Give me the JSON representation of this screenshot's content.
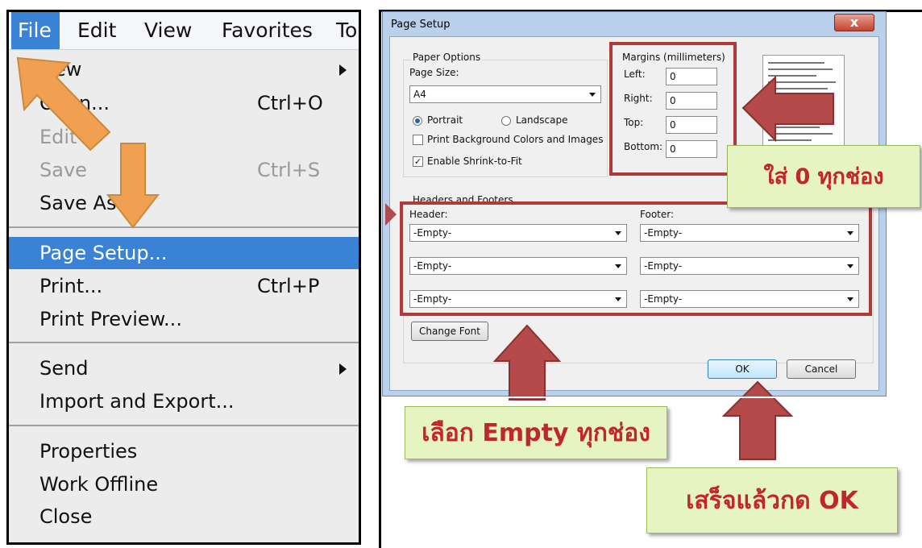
{
  "menubar": {
    "items": [
      "File",
      "Edit",
      "View",
      "Favorites",
      "To"
    ]
  },
  "file_menu": {
    "items": [
      {
        "label": "New",
        "submenu": true
      },
      {
        "label": "Open...",
        "shortcut": "Ctrl+O"
      },
      {
        "label": "Edit",
        "disabled": true
      },
      {
        "label": "Save",
        "shortcut": "Ctrl+S",
        "disabled": true
      },
      {
        "label": "Save As..."
      },
      {
        "label": "Page Setup...",
        "selected": true
      },
      {
        "label": "Print...",
        "shortcut": "Ctrl+P"
      },
      {
        "label": "Print Preview..."
      },
      {
        "label": "Send",
        "submenu": true
      },
      {
        "label": "Import and Export..."
      },
      {
        "label": "Properties"
      },
      {
        "label": "Work Offline"
      },
      {
        "label": "Close"
      }
    ]
  },
  "page_setup": {
    "title": "Page Setup",
    "close_glyph": "x",
    "paper_options": {
      "group_label": "Paper Options",
      "page_size_label": "Page Size:",
      "page_size_value": "A4",
      "portrait_label": "Portrait",
      "landscape_label": "Landscape",
      "orientation": "Portrait",
      "print_background_label": "Print Background Colors and Images",
      "print_background_checked": false,
      "shrink_label": "Enable Shrink-to-Fit",
      "shrink_checked": true
    },
    "margins": {
      "group_label": "Margins (millimeters)",
      "left_label": "Left:",
      "left_value": "0",
      "right_label": "Right:",
      "right_value": "0",
      "top_label": "Top:",
      "top_value": "0",
      "bottom_label": "Bottom:",
      "bottom_value": "0"
    },
    "headers_footers": {
      "group_label": "Headers and Footers",
      "header_label": "Header:",
      "footer_label": "Footer:",
      "header_values": [
        "-Empty-",
        "-Empty-",
        "-Empty-"
      ],
      "footer_values": [
        "-Empty-",
        "-Empty-",
        "-Empty-"
      ]
    },
    "change_font_label": "Change Font",
    "ok_label": "OK",
    "cancel_label": "Cancel"
  },
  "annotations": {
    "margins_note": "ใส่ 0 ทุกช่อง",
    "headers_note": "เลือก Empty ทุกช่อง",
    "ok_note": "เสร็จแล้วกด  OK",
    "colors": {
      "box": "#b03a3a",
      "arrow": "#b54a4a",
      "menu_arrow": "#f0a050",
      "callout_bg": "#e6f3c2",
      "callout_text": "#c0262c"
    }
  }
}
